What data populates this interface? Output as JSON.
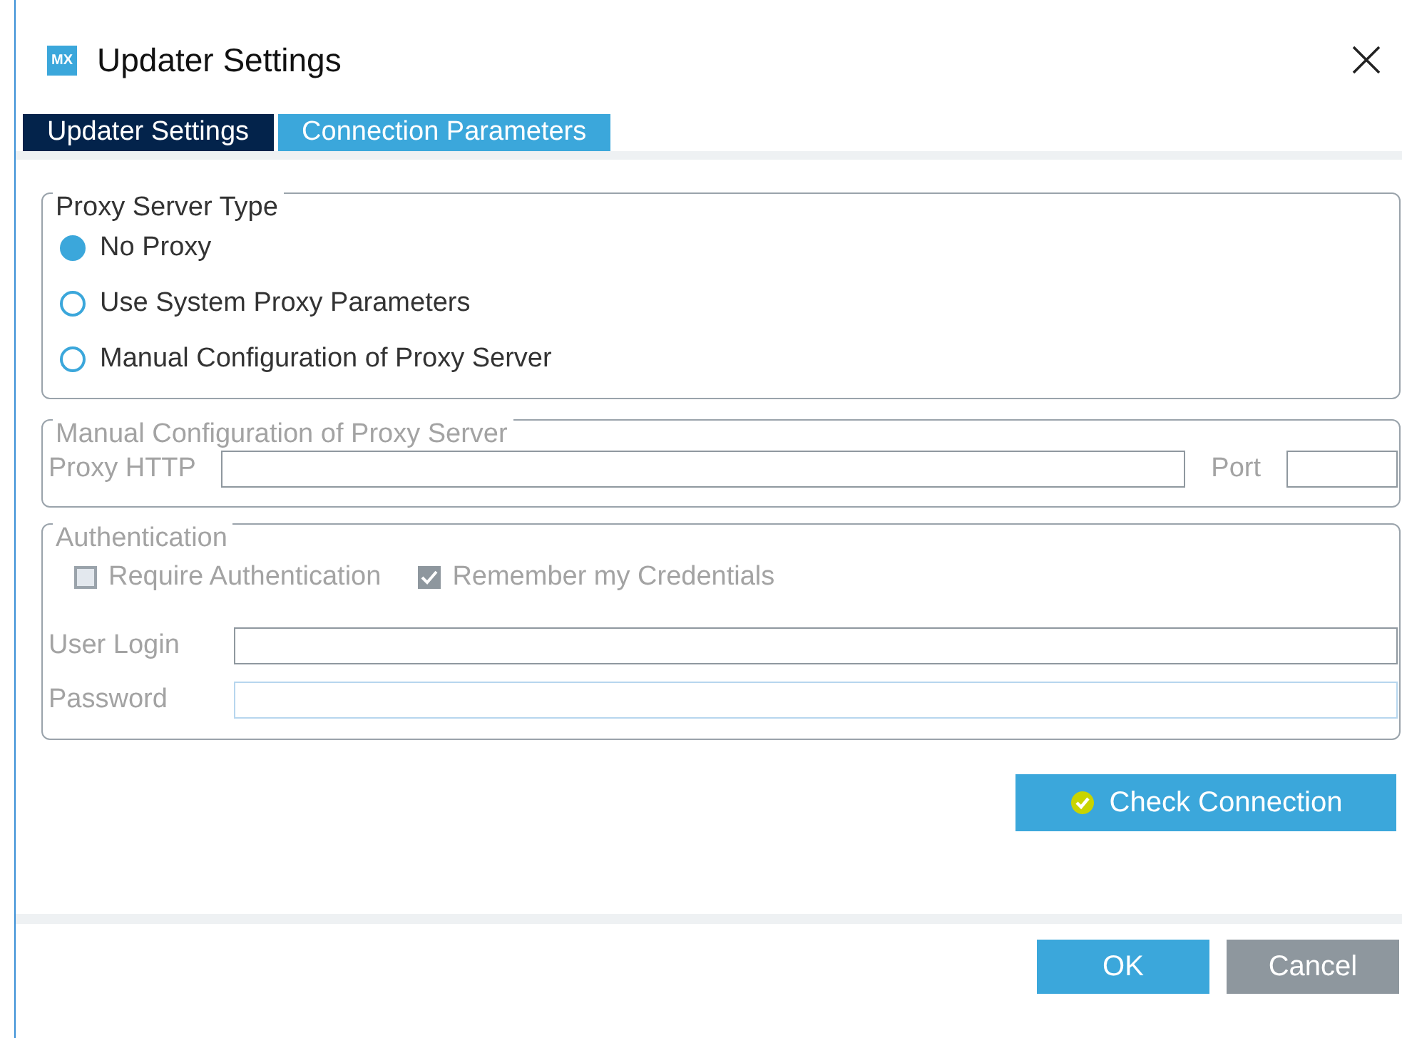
{
  "window": {
    "title": "Updater Settings",
    "logo": "MX"
  },
  "tabs": [
    {
      "label": "Updater Settings",
      "selected": false
    },
    {
      "label": "Connection Parameters",
      "selected": true
    }
  ],
  "proxy_type": {
    "title": "Proxy Server Type",
    "disabled": false,
    "options": [
      {
        "label": "No Proxy",
        "selected": true
      },
      {
        "label": "Use System Proxy Parameters",
        "selected": false
      },
      {
        "label": "Manual Configuration of Proxy Server",
        "selected": false
      }
    ]
  },
  "manual": {
    "title": "Manual Configuration of Proxy Server",
    "disabled": true,
    "proxy_label": "Proxy HTTP",
    "port_label": "Port"
  },
  "auth": {
    "title": "Authentication",
    "disabled": true,
    "checkboxes": [
      {
        "label": "Require Authentication",
        "checked": false
      },
      {
        "label": "Remember my Credentials",
        "checked": true
      }
    ],
    "fields": [
      {
        "label": "User Login",
        "focused": false
      },
      {
        "label": "Password",
        "focused": true
      }
    ]
  },
  "check_button": "Check Connection",
  "buttons": [
    {
      "label": "OK",
      "kind": "primary"
    },
    {
      "label": "Cancel",
      "kind": "secondary"
    }
  ]
}
